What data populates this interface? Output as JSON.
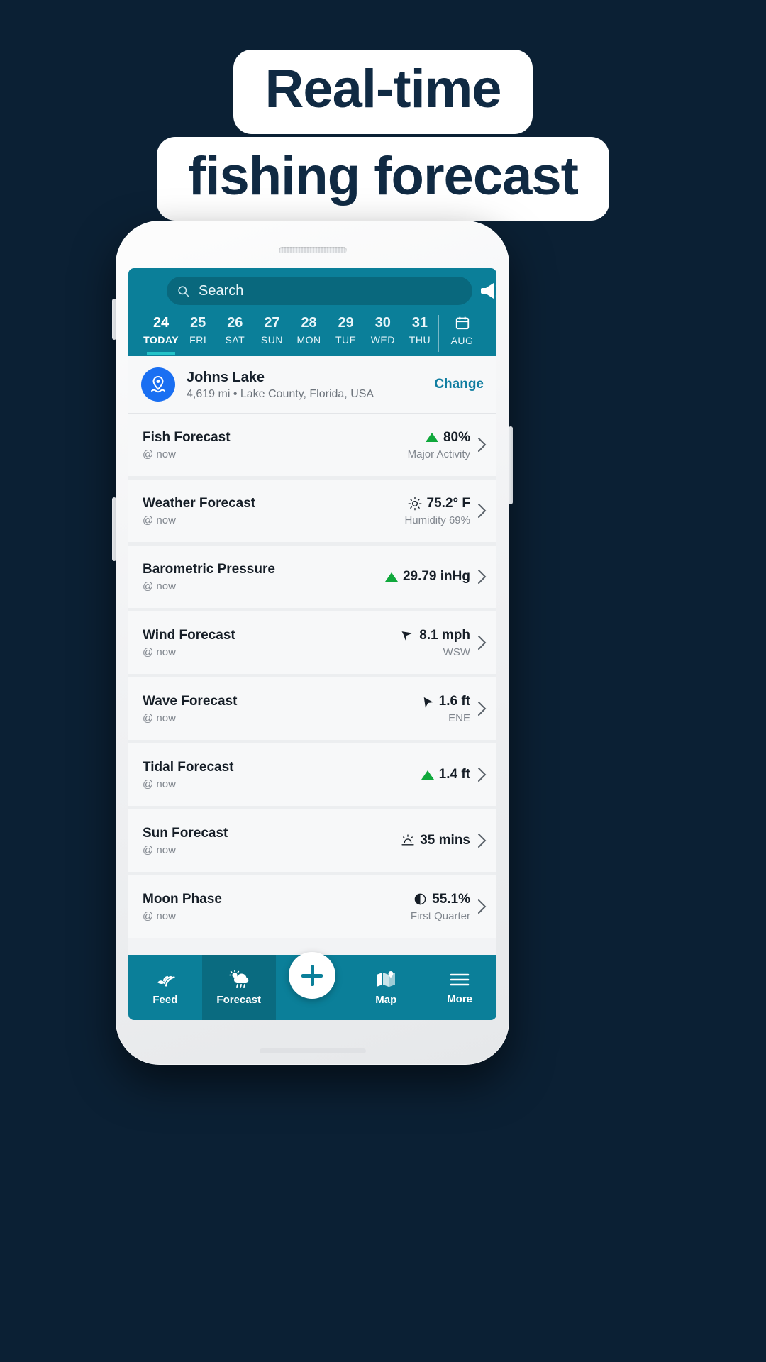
{
  "promo": {
    "line1": "Real-time",
    "line2": "fishing forecast"
  },
  "colors": {
    "background": "#0b2034",
    "header_teal": "#0b7f99",
    "header_teal_dark": "#0a6b80",
    "accent_cyan": "#23c3c8",
    "link_teal": "#0f7da0",
    "pin_blue": "#1a6ff2",
    "up_green": "#10a83c",
    "text_dark": "#161e27",
    "text_muted": "#80868e",
    "promo_navy": "#102a43"
  },
  "search": {
    "placeholder": "Search",
    "icon": "search-icon",
    "megaphone_icon": "megaphone-icon"
  },
  "date_strip": {
    "days": [
      {
        "num": "24",
        "label": "TODAY",
        "active": true
      },
      {
        "num": "25",
        "label": "FRI",
        "active": false
      },
      {
        "num": "26",
        "label": "SAT",
        "active": false
      },
      {
        "num": "27",
        "label": "SUN",
        "active": false
      },
      {
        "num": "28",
        "label": "MON",
        "active": false
      },
      {
        "num": "29",
        "label": "TUE",
        "active": false
      },
      {
        "num": "30",
        "label": "WED",
        "active": false
      },
      {
        "num": "31",
        "label": "THU",
        "active": false
      }
    ],
    "month": {
      "label": "AUG",
      "icon": "calendar-icon"
    }
  },
  "location": {
    "icon": "location-pin-icon",
    "name": "Johns Lake",
    "details": "4,619 mi • Lake County, Florida, USA",
    "change_label": "Change"
  },
  "forecast_rows": [
    {
      "title": "Fish Forecast",
      "subtitle": "@ now",
      "icon": "triangle-up-icon",
      "value": "80%",
      "value_sub": "Major Activity"
    },
    {
      "title": "Weather Forecast",
      "subtitle": "@ now",
      "icon": "sun-icon",
      "value": "75.2° F",
      "value_sub": "Humidity 69%"
    },
    {
      "title": "Barometric Pressure",
      "subtitle": "@ now",
      "icon": "triangle-up-icon",
      "value": "29.79 inHg",
      "value_sub": ""
    },
    {
      "title": "Wind Forecast",
      "subtitle": "@ now",
      "icon": "wind-arrow-icon",
      "value": "8.1 mph",
      "value_sub": "WSW"
    },
    {
      "title": "Wave Forecast",
      "subtitle": "@ now",
      "icon": "wave-arrow-icon",
      "value": "1.6 ft",
      "value_sub": "ENE"
    },
    {
      "title": "Tidal Forecast",
      "subtitle": "@ now",
      "icon": "triangle-up-icon",
      "value": "1.4 ft",
      "value_sub": ""
    },
    {
      "title": "Sun Forecast",
      "subtitle": "@ now",
      "icon": "sunset-icon",
      "value": "35 mins",
      "value_sub": ""
    },
    {
      "title": "Moon Phase",
      "subtitle": "@ now",
      "icon": "moon-phase-icon",
      "value": "55.1%",
      "value_sub": "First Quarter"
    }
  ],
  "bottom_nav": {
    "items": [
      {
        "label": "Feed",
        "icon": "fish-sonar-icon",
        "active": false
      },
      {
        "label": "Forecast",
        "icon": "weather-cloud-icon",
        "active": true
      },
      {
        "label": "Map",
        "icon": "map-icon",
        "active": false
      },
      {
        "label": "More",
        "icon": "hamburger-icon",
        "active": false
      }
    ],
    "fab": {
      "icon": "plus-icon"
    }
  }
}
